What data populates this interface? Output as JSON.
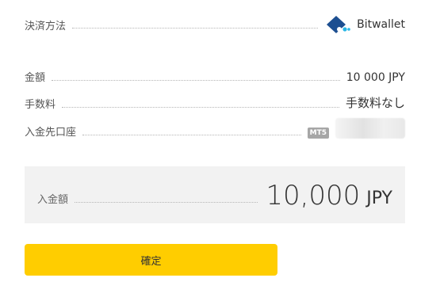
{
  "payment": {
    "method_label": "決済方法",
    "method_name": "Bitwallet",
    "method_icon": "bitwallet-logo-icon"
  },
  "details": {
    "amount_label": "金額",
    "amount_value": "10 000 JPY",
    "fee_label": "手数料",
    "fee_value": "手数料なし",
    "account_label": "入金先口座",
    "account_badge": "MT5"
  },
  "total": {
    "label": "入金額",
    "value": "10,000",
    "currency": "JPY"
  },
  "actions": {
    "confirm_label": "確定"
  },
  "colors": {
    "accent_button": "#ffcd00",
    "brand_blue": "#1d4f91",
    "brand_cyan": "#2ab7e6",
    "total_background": "#f2f2f2"
  }
}
